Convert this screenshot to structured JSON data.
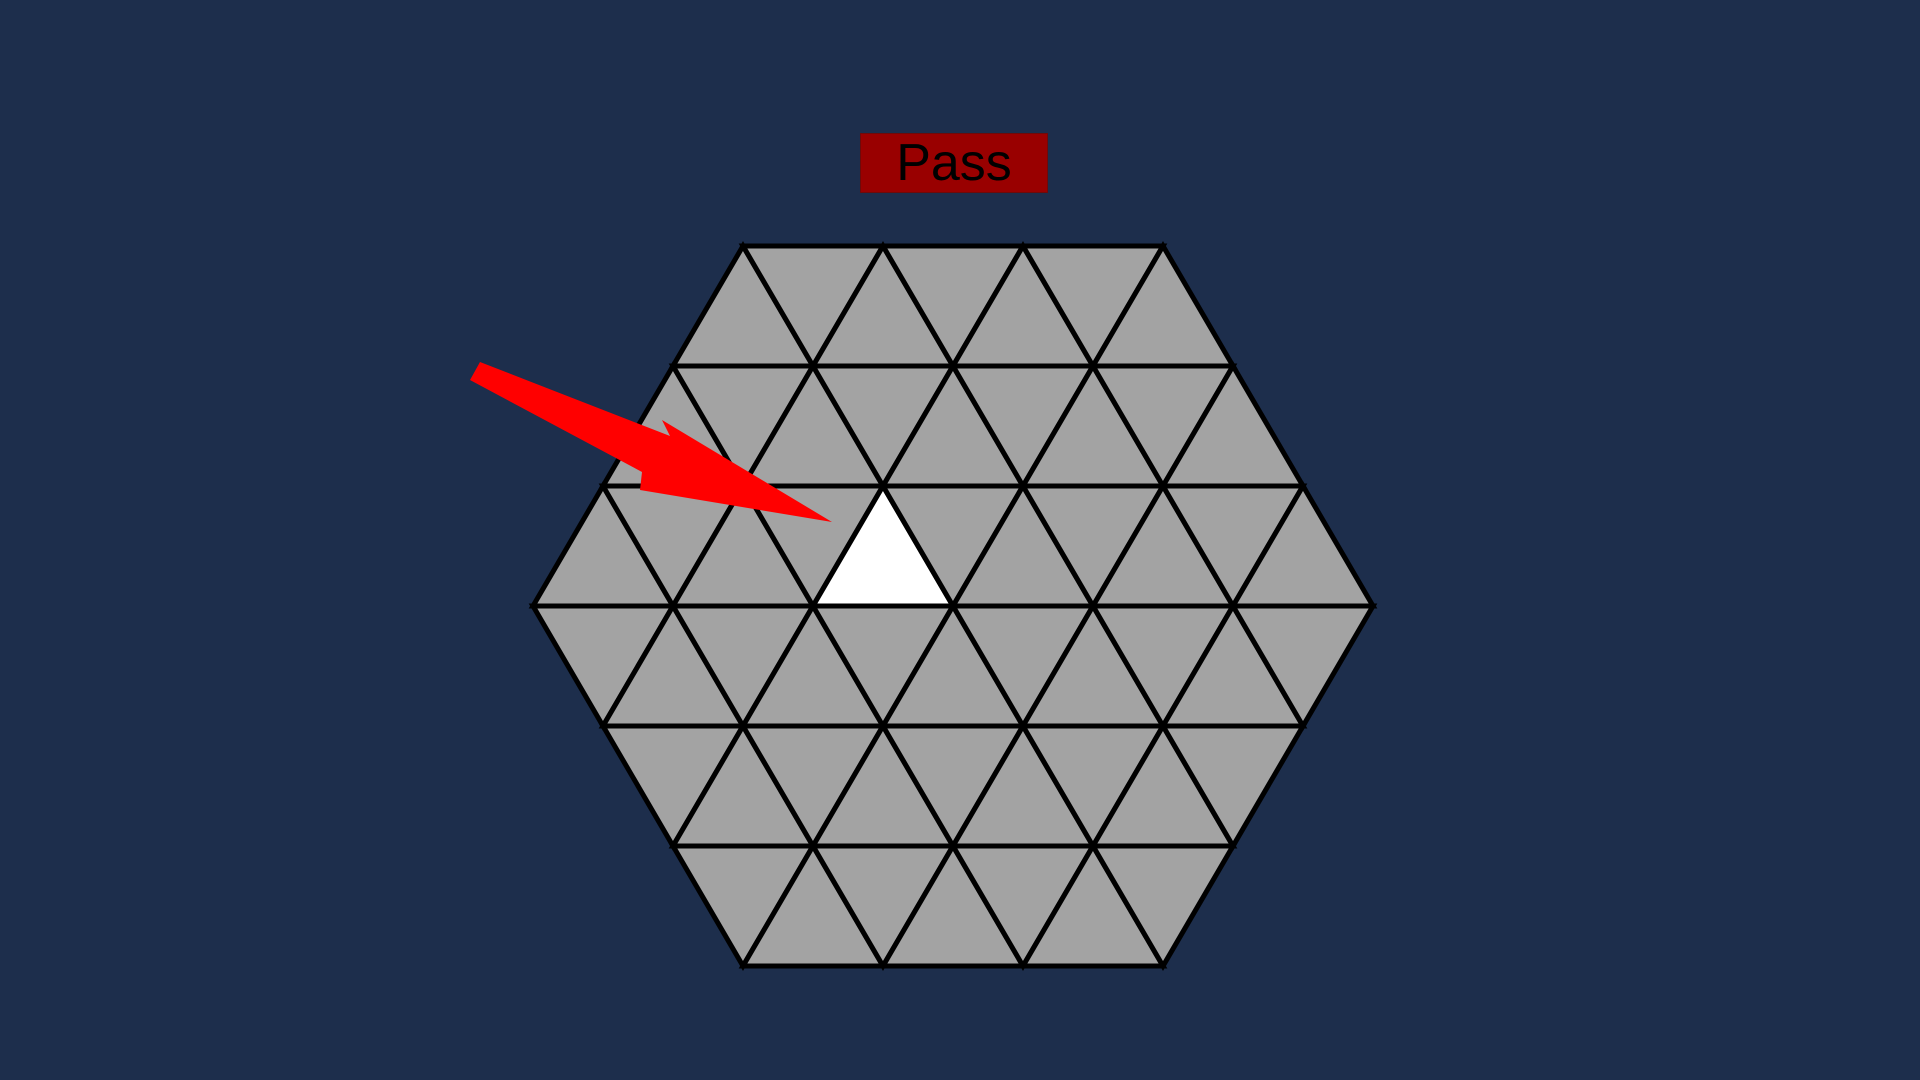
{
  "pass_button": {
    "label": "Pass"
  },
  "board": {
    "shape": "hexagon",
    "side_length_in_triangles": 3,
    "total_triangles": 54,
    "selected_cell": {
      "row": 2,
      "index": 4
    },
    "colors": {
      "background": "#1d2e4c",
      "cell_fill": "#a3a3a3",
      "selected_fill": "#ffffff",
      "grid_line": "#000000",
      "button_fill": "#990000",
      "pointer_arrow": "#ff0000"
    }
  },
  "pointer": {
    "icon": "red-arrow-icon",
    "target": "selected-cell"
  }
}
